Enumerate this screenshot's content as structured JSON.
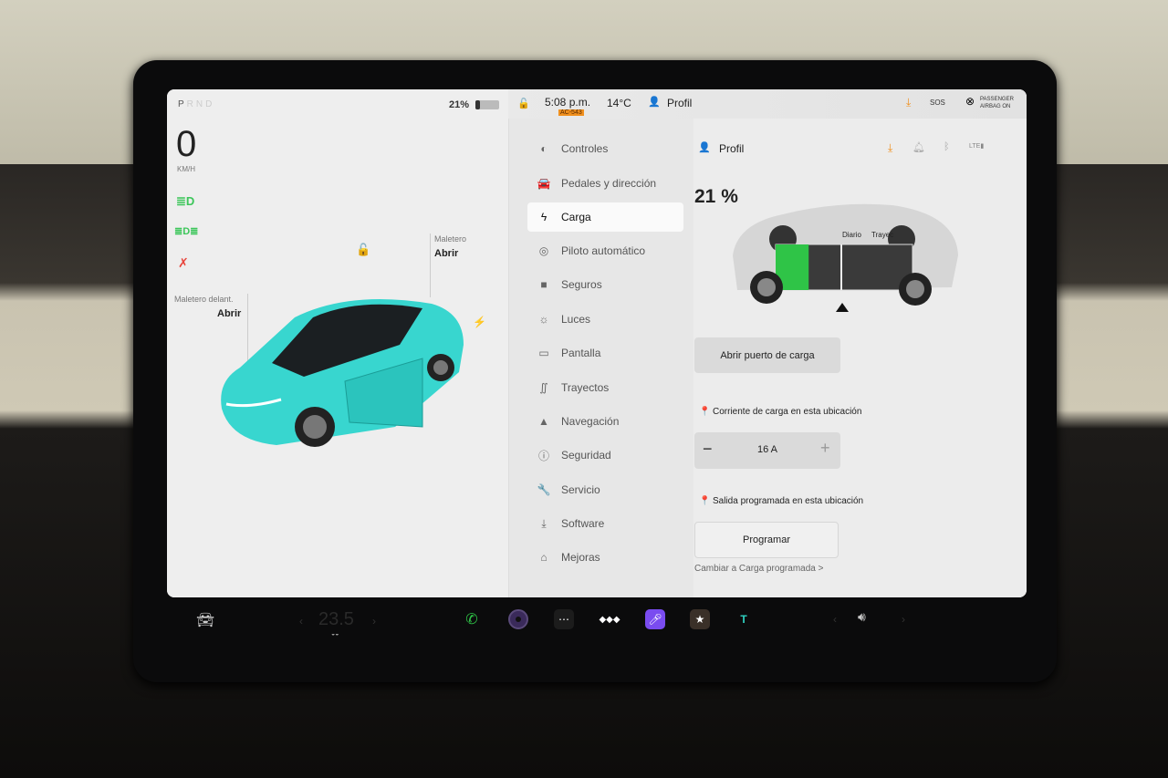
{
  "status": {
    "gears": [
      "P",
      "R",
      "N",
      "D"
    ],
    "active_gear": "P",
    "speed": "0",
    "speed_unit": "KM/H",
    "battery_percent": "21%",
    "time": "5:08 p.m.",
    "plate_tag": "AC-543",
    "temperature": "14°C",
    "profile": "Profil",
    "sos": "SOS",
    "airbag_line1": "PASSENGER",
    "airbag_line2": "AIRBAG ON"
  },
  "car": {
    "frunk_label": "Maletero delant.",
    "frunk_action": "Abrir",
    "trunk_label": "Maletero",
    "trunk_action": "Abrir",
    "color": "#38d6cf"
  },
  "menu": {
    "items": [
      {
        "label": "Controles",
        "icon": "toggle-icon"
      },
      {
        "label": "Pedales y dirección",
        "icon": "car-icon"
      },
      {
        "label": "Carga",
        "icon": "bolt-icon",
        "active": true
      },
      {
        "label": "Piloto automático",
        "icon": "steering-wheel-icon"
      },
      {
        "label": "Seguros",
        "icon": "lock-icon"
      },
      {
        "label": "Luces",
        "icon": "sun-icon"
      },
      {
        "label": "Pantalla",
        "icon": "display-icon"
      },
      {
        "label": "Trayectos",
        "icon": "trips-icon"
      },
      {
        "label": "Navegación",
        "icon": "navigation-icon"
      },
      {
        "label": "Seguridad",
        "icon": "safety-icon"
      },
      {
        "label": "Servicio",
        "icon": "wrench-icon"
      },
      {
        "label": "Software",
        "icon": "download-icon"
      },
      {
        "label": "Mejoras",
        "icon": "bag-icon"
      }
    ]
  },
  "charging": {
    "profile": "Profil",
    "battery_level": "21 %",
    "battery_fraction": 0.21,
    "diario": "Diario",
    "trayecto": "Trayecto",
    "open_port": "Abrir puerto de carga",
    "current_label": "Corriente de carga en esta ubicación",
    "current_value": "16 A",
    "departure_label": "Salida programada en esta ubicación",
    "schedule_button": "Programar",
    "scheduled_link": "Cambiar a Carga programada >"
  },
  "bottombar": {
    "cabin_temp": "23.5",
    "apps": [
      "phone",
      "camera",
      "more",
      "tidal",
      "karaoke",
      "toybox",
      "theater"
    ]
  },
  "colors": {
    "accent_green": "#2fc447",
    "warning_red": "#e8453c",
    "download_orange": "#f0901e",
    "indicator_green": "#3cc65a"
  }
}
